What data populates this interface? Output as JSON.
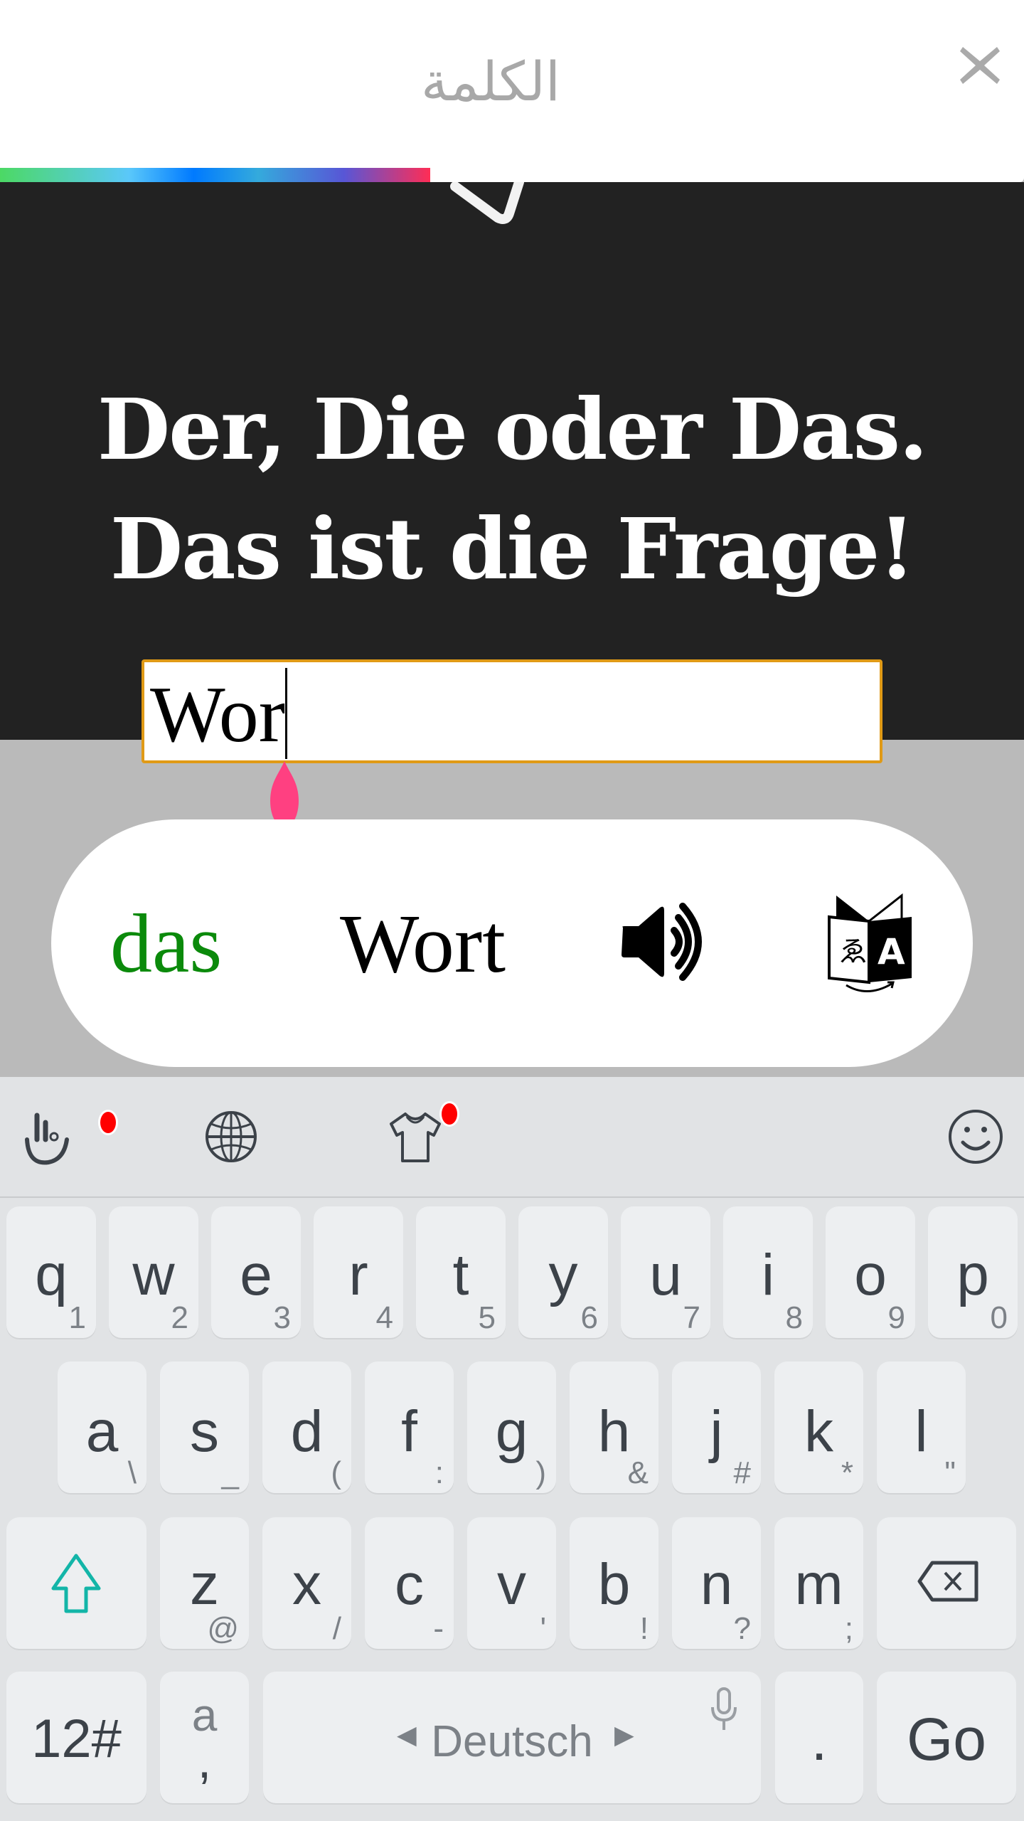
{
  "header": {
    "title": "الكلمة",
    "close_icon": "close-icon",
    "progress_percent": 42,
    "progress_gradient": [
      "#4cd964",
      "#5ac8fa",
      "#007aff",
      "#5856d6",
      "#ff2d55"
    ]
  },
  "prompt": {
    "line1": "Der, Die oder Das.",
    "line2": "Das ist die Frage!"
  },
  "answer_input": {
    "value": "Wor",
    "border_color": "#e09a16"
  },
  "result_card": {
    "article": "das",
    "article_color": "#0b8a0b",
    "noun": "Wort",
    "speaker_icon": "speaker-icon",
    "translate_icon": "translate-icon"
  },
  "keyboard": {
    "toolbar": [
      {
        "icon": "gesture-hand-icon",
        "badge": true
      },
      {
        "icon": "globe-icon",
        "badge": false
      },
      {
        "icon": "theme-shirt-icon",
        "badge": true
      },
      {
        "icon": "emoji-icon",
        "badge": false
      }
    ],
    "row1": [
      {
        "main": "q",
        "sub": "1"
      },
      {
        "main": "w",
        "sub": "2"
      },
      {
        "main": "e",
        "sub": "3"
      },
      {
        "main": "r",
        "sub": "4"
      },
      {
        "main": "t",
        "sub": "5"
      },
      {
        "main": "y",
        "sub": "6"
      },
      {
        "main": "u",
        "sub": "7"
      },
      {
        "main": "i",
        "sub": "8"
      },
      {
        "main": "o",
        "sub": "9"
      },
      {
        "main": "p",
        "sub": "0"
      }
    ],
    "row2": [
      {
        "main": "a",
        "sub": "\\"
      },
      {
        "main": "s",
        "sub": "_"
      },
      {
        "main": "d",
        "sub": "("
      },
      {
        "main": "f",
        "sub": ":"
      },
      {
        "main": "g",
        "sub": ")"
      },
      {
        "main": "h",
        "sub": "&"
      },
      {
        "main": "j",
        "sub": "#"
      },
      {
        "main": "k",
        "sub": "*"
      },
      {
        "main": "l",
        "sub": "\""
      }
    ],
    "row3": [
      {
        "main": "z",
        "sub": "@"
      },
      {
        "main": "x",
        "sub": "/"
      },
      {
        "main": "c",
        "sub": "-"
      },
      {
        "main": "v",
        "sub": "'"
      },
      {
        "main": "b",
        "sub": "!"
      },
      {
        "main": "n",
        "sub": "?"
      },
      {
        "main": "m",
        "sub": ";"
      }
    ],
    "shift_icon": "shift-icon",
    "backspace_icon": "backspace-icon",
    "symbols_label": "12#",
    "comma_key": {
      "top": "a",
      "bottom": ","
    },
    "space_label": "Deutsch",
    "period_label": ".",
    "go_label": "Go",
    "accent_color": "#13b5a8"
  }
}
